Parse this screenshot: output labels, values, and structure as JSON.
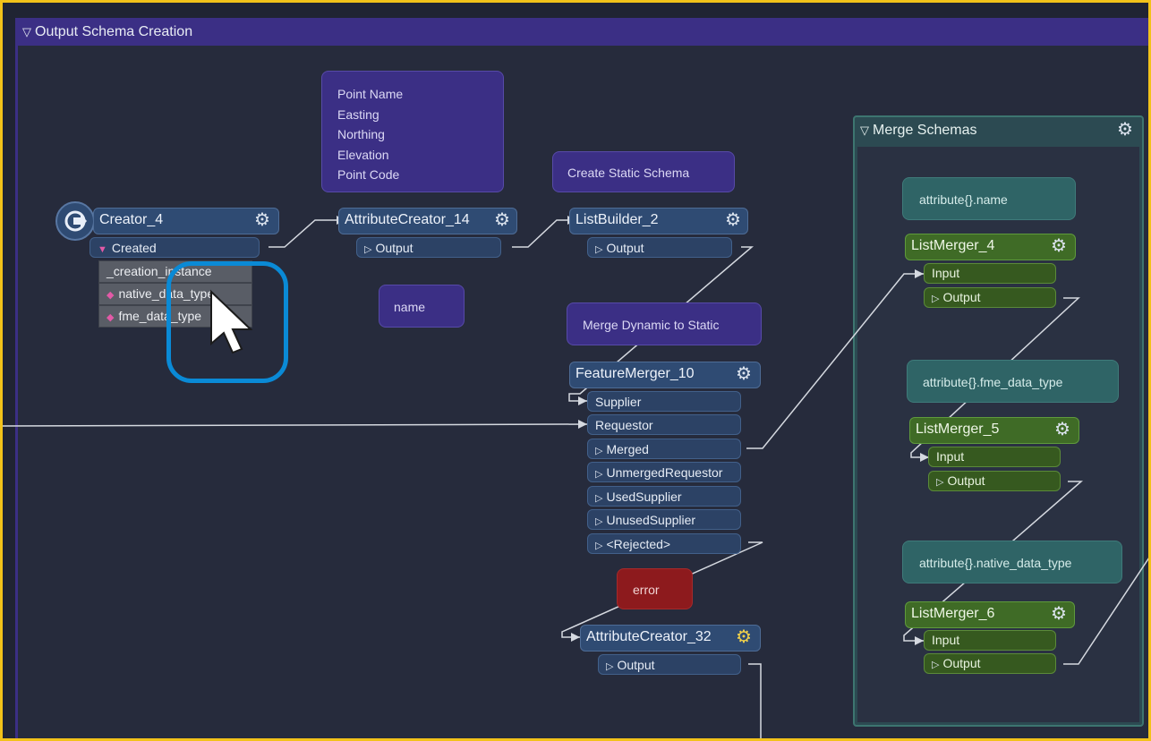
{
  "bookmark": {
    "title": "Output Schema Creation",
    "collapse_glyph": "▽"
  },
  "merge_bookmark": {
    "title": "Merge Schemas",
    "collapse_glyph": "▽",
    "gear_icon": "⚙"
  },
  "annotations": {
    "attr_creator_14": [
      "Point Name",
      "Easting",
      "Northing",
      "Elevation",
      "Point Code"
    ],
    "name_note": "name",
    "static_schema": "Create Static Schema",
    "merge_dynamic": "Merge Dynamic to Static",
    "error_note": "error",
    "lm4_note": "attribute{}.name",
    "lm5_note": "attribute{}.fme_data_type",
    "lm6_note": "attribute{}.native_data_type"
  },
  "creator": {
    "name": "Creator_4",
    "port": "Created",
    "attributes": [
      "_creation_instance",
      "native_data_type",
      "fme_data_type"
    ]
  },
  "attribute_creator_14": {
    "name": "AttributeCreator_14",
    "output": "Output"
  },
  "list_builder": {
    "name": "ListBuilder_2",
    "output": "Output"
  },
  "feature_merger": {
    "name": "FeatureMerger_10",
    "inputs": [
      "Supplier",
      "Requestor"
    ],
    "outputs": [
      "Merged",
      "UnmergedRequestor",
      "UsedSupplier",
      "UnusedSupplier",
      "<Rejected>"
    ]
  },
  "attribute_creator_32": {
    "name": "AttributeCreator_32",
    "output": "Output"
  },
  "list_merger_4": {
    "name": "ListMerger_4",
    "input": "Input",
    "output": "Output"
  },
  "list_merger_5": {
    "name": "ListMerger_5",
    "input": "Input",
    "output": "Output"
  },
  "list_merger_6": {
    "name": "ListMerger_6",
    "input": "Input",
    "output": "Output"
  },
  "colors": {
    "selection": "#f2c21a",
    "bookmark": "#3b2f85",
    "transformer": "#2f4b73",
    "list_merger": "#3f6b26",
    "cursor_highlight": "#0a8ad6"
  }
}
